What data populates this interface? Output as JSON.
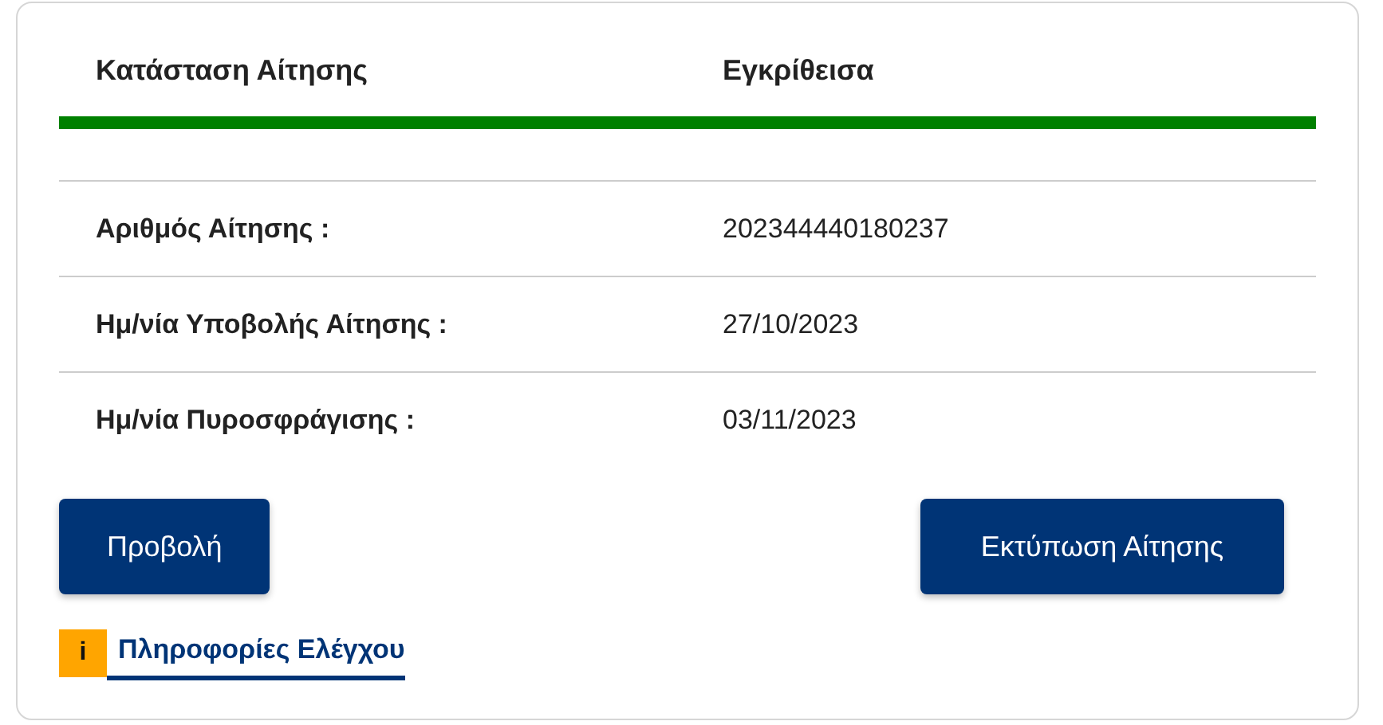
{
  "status": {
    "label": "Κατάσταση Αίτησης",
    "value": "Εγκρίθεισα",
    "color": "#008000"
  },
  "details": [
    {
      "label": "Αριθμός Αίτησης :",
      "value": "202344440180237"
    },
    {
      "label": "Ημ/νία Υποβολής Αίτησης :",
      "value": "27/10/2023"
    },
    {
      "label": "Ημ/νία Πυροσφράγισης :",
      "value": "03/11/2023"
    }
  ],
  "buttons": [
    "Προβολή",
    "Εκτύπωση Αίτησης"
  ],
  "info": {
    "icon": "i",
    "link": "Πληροφορίες Ελέγχου"
  }
}
